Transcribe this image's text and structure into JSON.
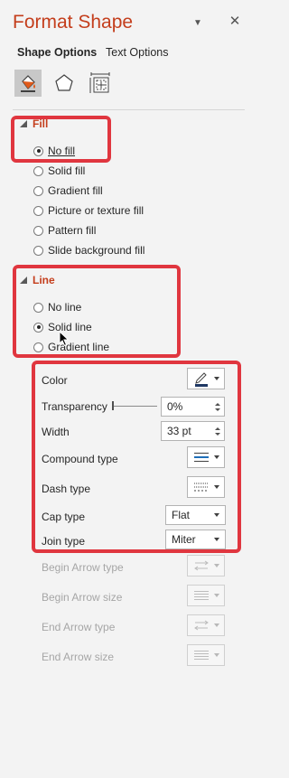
{
  "header": {
    "title": "Format Shape",
    "dropdown_glyph": "▼",
    "close_glyph": "✕"
  },
  "tabs": {
    "shape_options": "Shape Options",
    "text_options": "Text Options"
  },
  "icon_row": [
    {
      "name": "fill-line-icon",
      "active": true
    },
    {
      "name": "effects-icon",
      "active": false
    },
    {
      "name": "size-properties-icon",
      "active": false
    }
  ],
  "fill": {
    "heading": "Fill",
    "options": [
      {
        "label": "No fill",
        "checked": true
      },
      {
        "label": "Solid fill",
        "checked": false
      },
      {
        "label": "Gradient fill",
        "checked": false
      },
      {
        "label": "Picture or texture fill",
        "checked": false
      },
      {
        "label": "Pattern fill",
        "checked": false
      },
      {
        "label": "Slide background fill",
        "checked": false
      }
    ]
  },
  "line": {
    "heading": "Line",
    "options": [
      {
        "label": "No line",
        "checked": false
      },
      {
        "label": "Solid line",
        "checked": true
      },
      {
        "label": "Gradient line",
        "checked": false
      }
    ]
  },
  "props": {
    "color": "Color",
    "transparency": "Transparency",
    "transparency_value": "0%",
    "width": "Width",
    "width_value": "33 pt",
    "compound_type": "Compound type",
    "dash_type": "Dash type",
    "cap_type": "Cap type",
    "cap_value": "Flat",
    "join_type": "Join type",
    "join_value": "Miter",
    "begin_arrow_type": "Begin Arrow type",
    "begin_arrow_size": "Begin Arrow size",
    "end_arrow_type": "End Arrow type",
    "end_arrow_size": "End Arrow size"
  },
  "colors": {
    "accent": "#c43e1c",
    "highlight_box": "#e0363f",
    "line_color_swatch": "#1f3864"
  }
}
